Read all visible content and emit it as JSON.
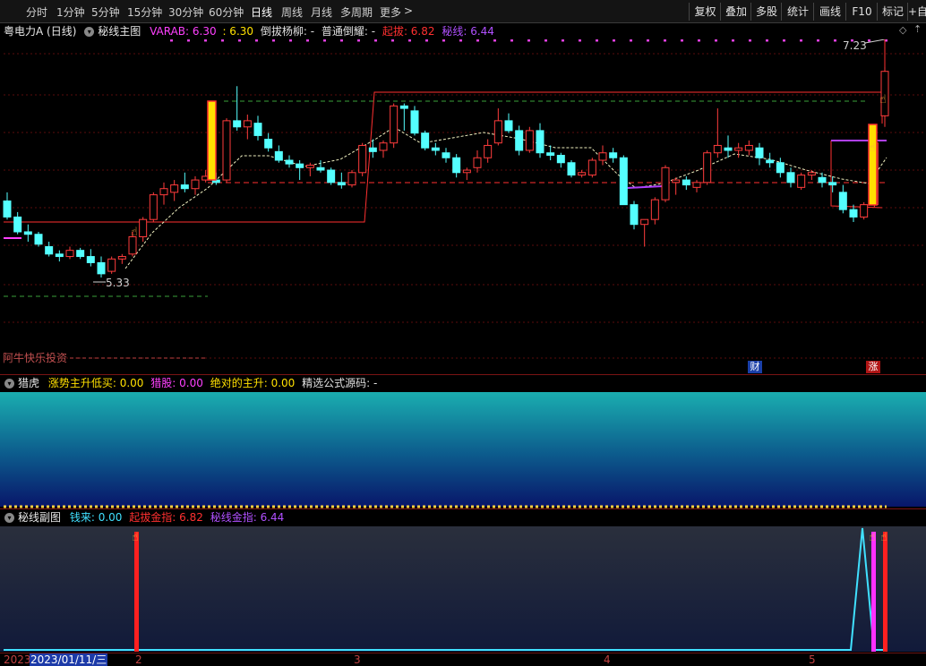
{
  "toolbar": {
    "periods": [
      "分时",
      "1分钟",
      "5分钟",
      "15分钟",
      "30分钟",
      "60分钟",
      "日线",
      "周线",
      "月线",
      "多周期",
      "更多"
    ],
    "active_period": "日线",
    "more_arrow": ">",
    "buttons": [
      "复权",
      "叠加",
      "多股",
      "统计",
      "画线",
      "F10",
      "标记",
      "+自"
    ]
  },
  "main_panel": {
    "stock_name": "粤电力A",
    "period_label": "(日线)",
    "indicator_name": "秘线主图",
    "varab_label": "VARAB",
    "varab_value": "6.30",
    "varab_value2": ": 6.30",
    "daobatyangliu": "倒拔杨柳: -",
    "putongdaoba": "普通倒耀: -",
    "qiba_label": "起拔",
    "qiba_value": "6.82",
    "mixian_label": "秘线",
    "mixian_value": "6.44",
    "high_label": "7.23",
    "low_label": "5.33",
    "watermark": "阿牛快乐投资",
    "badge_cai": "财",
    "badge_zhang": "涨",
    "colors": {
      "up": "#ff3c3c",
      "down": "#54ffff",
      "yellow": "#ffe000",
      "magenta": "#ff40ff",
      "purple": "#a040ff"
    }
  },
  "sub_panel1": {
    "name": "猎虎",
    "item1_label": "涨势主升低买",
    "item1_value": "0.00",
    "item2_label": "猎股",
    "item2_value": "0.00",
    "item3_label": "绝对的主升",
    "item3_value": "0.00",
    "item4": "精选公式源码: -"
  },
  "sub_panel2": {
    "name": "秘线副图",
    "item1_label": "钱来",
    "item1_value": "0.00",
    "item2_label": "起拔金指",
    "item2_value": "6.82",
    "item3_label": "秘线金指",
    "item3_value": "6.44"
  },
  "date_axis": {
    "year_label": "2023",
    "cursor_date": "2023/01/11/三",
    "month_labels": [
      "2",
      "3",
      "4",
      "5"
    ]
  },
  "chart_data": {
    "type": "candlestick",
    "ohlc": [
      [
        5.95,
        6.02,
        5.8,
        5.82
      ],
      [
        5.82,
        5.86,
        5.68,
        5.7
      ],
      [
        5.7,
        5.76,
        5.62,
        5.68
      ],
      [
        5.68,
        5.7,
        5.58,
        5.6
      ],
      [
        5.58,
        5.62,
        5.5,
        5.52
      ],
      [
        5.52,
        5.55,
        5.46,
        5.5
      ],
      [
        5.5,
        5.58,
        5.48,
        5.55
      ],
      [
        5.55,
        5.57,
        5.48,
        5.5
      ],
      [
        5.5,
        5.56,
        5.42,
        5.45
      ],
      [
        5.45,
        5.5,
        5.33,
        5.36
      ],
      [
        5.38,
        5.5,
        5.36,
        5.48
      ],
      [
        5.48,
        5.52,
        5.44,
        5.5
      ],
      [
        5.52,
        5.7,
        5.5,
        5.66
      ],
      [
        5.66,
        5.82,
        5.62,
        5.8
      ],
      [
        5.8,
        6.02,
        5.78,
        6.0
      ],
      [
        6.0,
        6.1,
        5.92,
        6.05
      ],
      [
        6.02,
        6.12,
        5.95,
        6.08
      ],
      [
        6.08,
        6.18,
        6.02,
        6.05
      ],
      [
        6.05,
        6.15,
        6.0,
        6.12
      ],
      [
        6.12,
        6.2,
        6.1,
        6.15
      ],
      [
        6.12,
        6.18,
        6.08,
        6.1
      ],
      [
        6.12,
        6.62,
        6.1,
        6.6
      ],
      [
        6.6,
        6.88,
        6.52,
        6.55
      ],
      [
        6.55,
        6.65,
        6.45,
        6.6
      ],
      [
        6.58,
        6.64,
        6.44,
        6.48
      ],
      [
        6.45,
        6.5,
        6.35,
        6.38
      ],
      [
        6.35,
        6.4,
        6.26,
        6.28
      ],
      [
        6.28,
        6.32,
        6.22,
        6.25
      ],
      [
        6.25,
        6.28,
        6.12,
        6.22
      ],
      [
        6.22,
        6.26,
        6.15,
        6.24
      ],
      [
        6.22,
        6.28,
        6.18,
        6.2
      ],
      [
        6.2,
        6.22,
        6.08,
        6.1
      ],
      [
        6.1,
        6.18,
        6.05,
        6.08
      ],
      [
        6.08,
        6.2,
        6.06,
        6.18
      ],
      [
        6.18,
        6.42,
        6.15,
        6.4
      ],
      [
        6.38,
        6.45,
        6.3,
        6.35
      ],
      [
        6.36,
        6.44,
        6.3,
        6.42
      ],
      [
        6.42,
        6.74,
        6.38,
        6.72
      ],
      [
        6.72,
        6.74,
        6.52,
        6.7
      ],
      [
        6.68,
        6.72,
        6.48,
        6.5
      ],
      [
        6.5,
        6.52,
        6.36,
        6.38
      ],
      [
        6.38,
        6.42,
        6.32,
        6.36
      ],
      [
        6.34,
        6.38,
        6.26,
        6.3
      ],
      [
        6.3,
        6.33,
        6.14,
        6.18
      ],
      [
        6.18,
        6.22,
        6.12,
        6.2
      ],
      [
        6.22,
        6.36,
        6.18,
        6.3
      ],
      [
        6.3,
        6.45,
        6.26,
        6.4
      ],
      [
        6.42,
        6.7,
        6.4,
        6.6
      ],
      [
        6.6,
        6.66,
        6.5,
        6.52
      ],
      [
        6.52,
        6.56,
        6.32,
        6.36
      ],
      [
        6.36,
        6.55,
        6.34,
        6.52
      ],
      [
        6.52,
        6.58,
        6.3,
        6.34
      ],
      [
        6.34,
        6.4,
        6.28,
        6.32
      ],
      [
        6.32,
        6.34,
        6.22,
        6.26
      ],
      [
        6.26,
        6.28,
        6.14,
        6.16
      ],
      [
        6.16,
        6.2,
        6.14,
        6.18
      ],
      [
        6.16,
        6.3,
        6.14,
        6.28
      ],
      [
        6.28,
        6.4,
        6.24,
        6.34
      ],
      [
        6.34,
        6.38,
        6.26,
        6.3
      ],
      [
        6.3,
        6.32,
        6.0,
        5.92
      ],
      [
        5.92,
        5.95,
        5.72,
        5.76
      ],
      [
        5.76,
        5.8,
        5.58,
        5.8
      ],
      [
        5.8,
        5.98,
        5.76,
        5.96
      ],
      [
        5.96,
        6.24,
        5.94,
        6.22
      ],
      [
        6.1,
        6.14,
        6.0,
        6.12
      ],
      [
        6.12,
        6.15,
        6.04,
        6.08
      ],
      [
        6.06,
        6.12,
        6.02,
        6.1
      ],
      [
        6.1,
        6.36,
        6.08,
        6.34
      ],
      [
        6.34,
        6.7,
        6.3,
        6.4
      ],
      [
        6.38,
        6.48,
        6.3,
        6.36
      ],
      [
        6.36,
        6.42,
        6.3,
        6.38
      ],
      [
        6.36,
        6.44,
        6.32,
        6.4
      ],
      [
        6.38,
        6.42,
        6.24,
        6.3
      ],
      [
        6.28,
        6.34,
        6.22,
        6.26
      ],
      [
        6.26,
        6.3,
        6.14,
        6.18
      ],
      [
        6.18,
        6.22,
        6.06,
        6.1
      ],
      [
        6.06,
        6.18,
        6.04,
        6.16
      ],
      [
        6.16,
        6.2,
        6.12,
        6.18
      ],
      [
        6.14,
        6.18,
        6.06,
        6.1
      ],
      [
        6.1,
        6.15,
        6.02,
        6.08
      ],
      [
        6.02,
        6.08,
        5.85,
        5.88
      ],
      [
        5.88,
        5.92,
        5.78,
        5.82
      ],
      [
        5.82,
        5.94,
        5.8,
        5.92
      ],
      [
        5.92,
        6.42,
        5.9,
        6.42
      ],
      [
        6.64,
        7.23,
        6.55,
        7.0
      ]
    ],
    "high": 7.23,
    "low": 5.33
  }
}
